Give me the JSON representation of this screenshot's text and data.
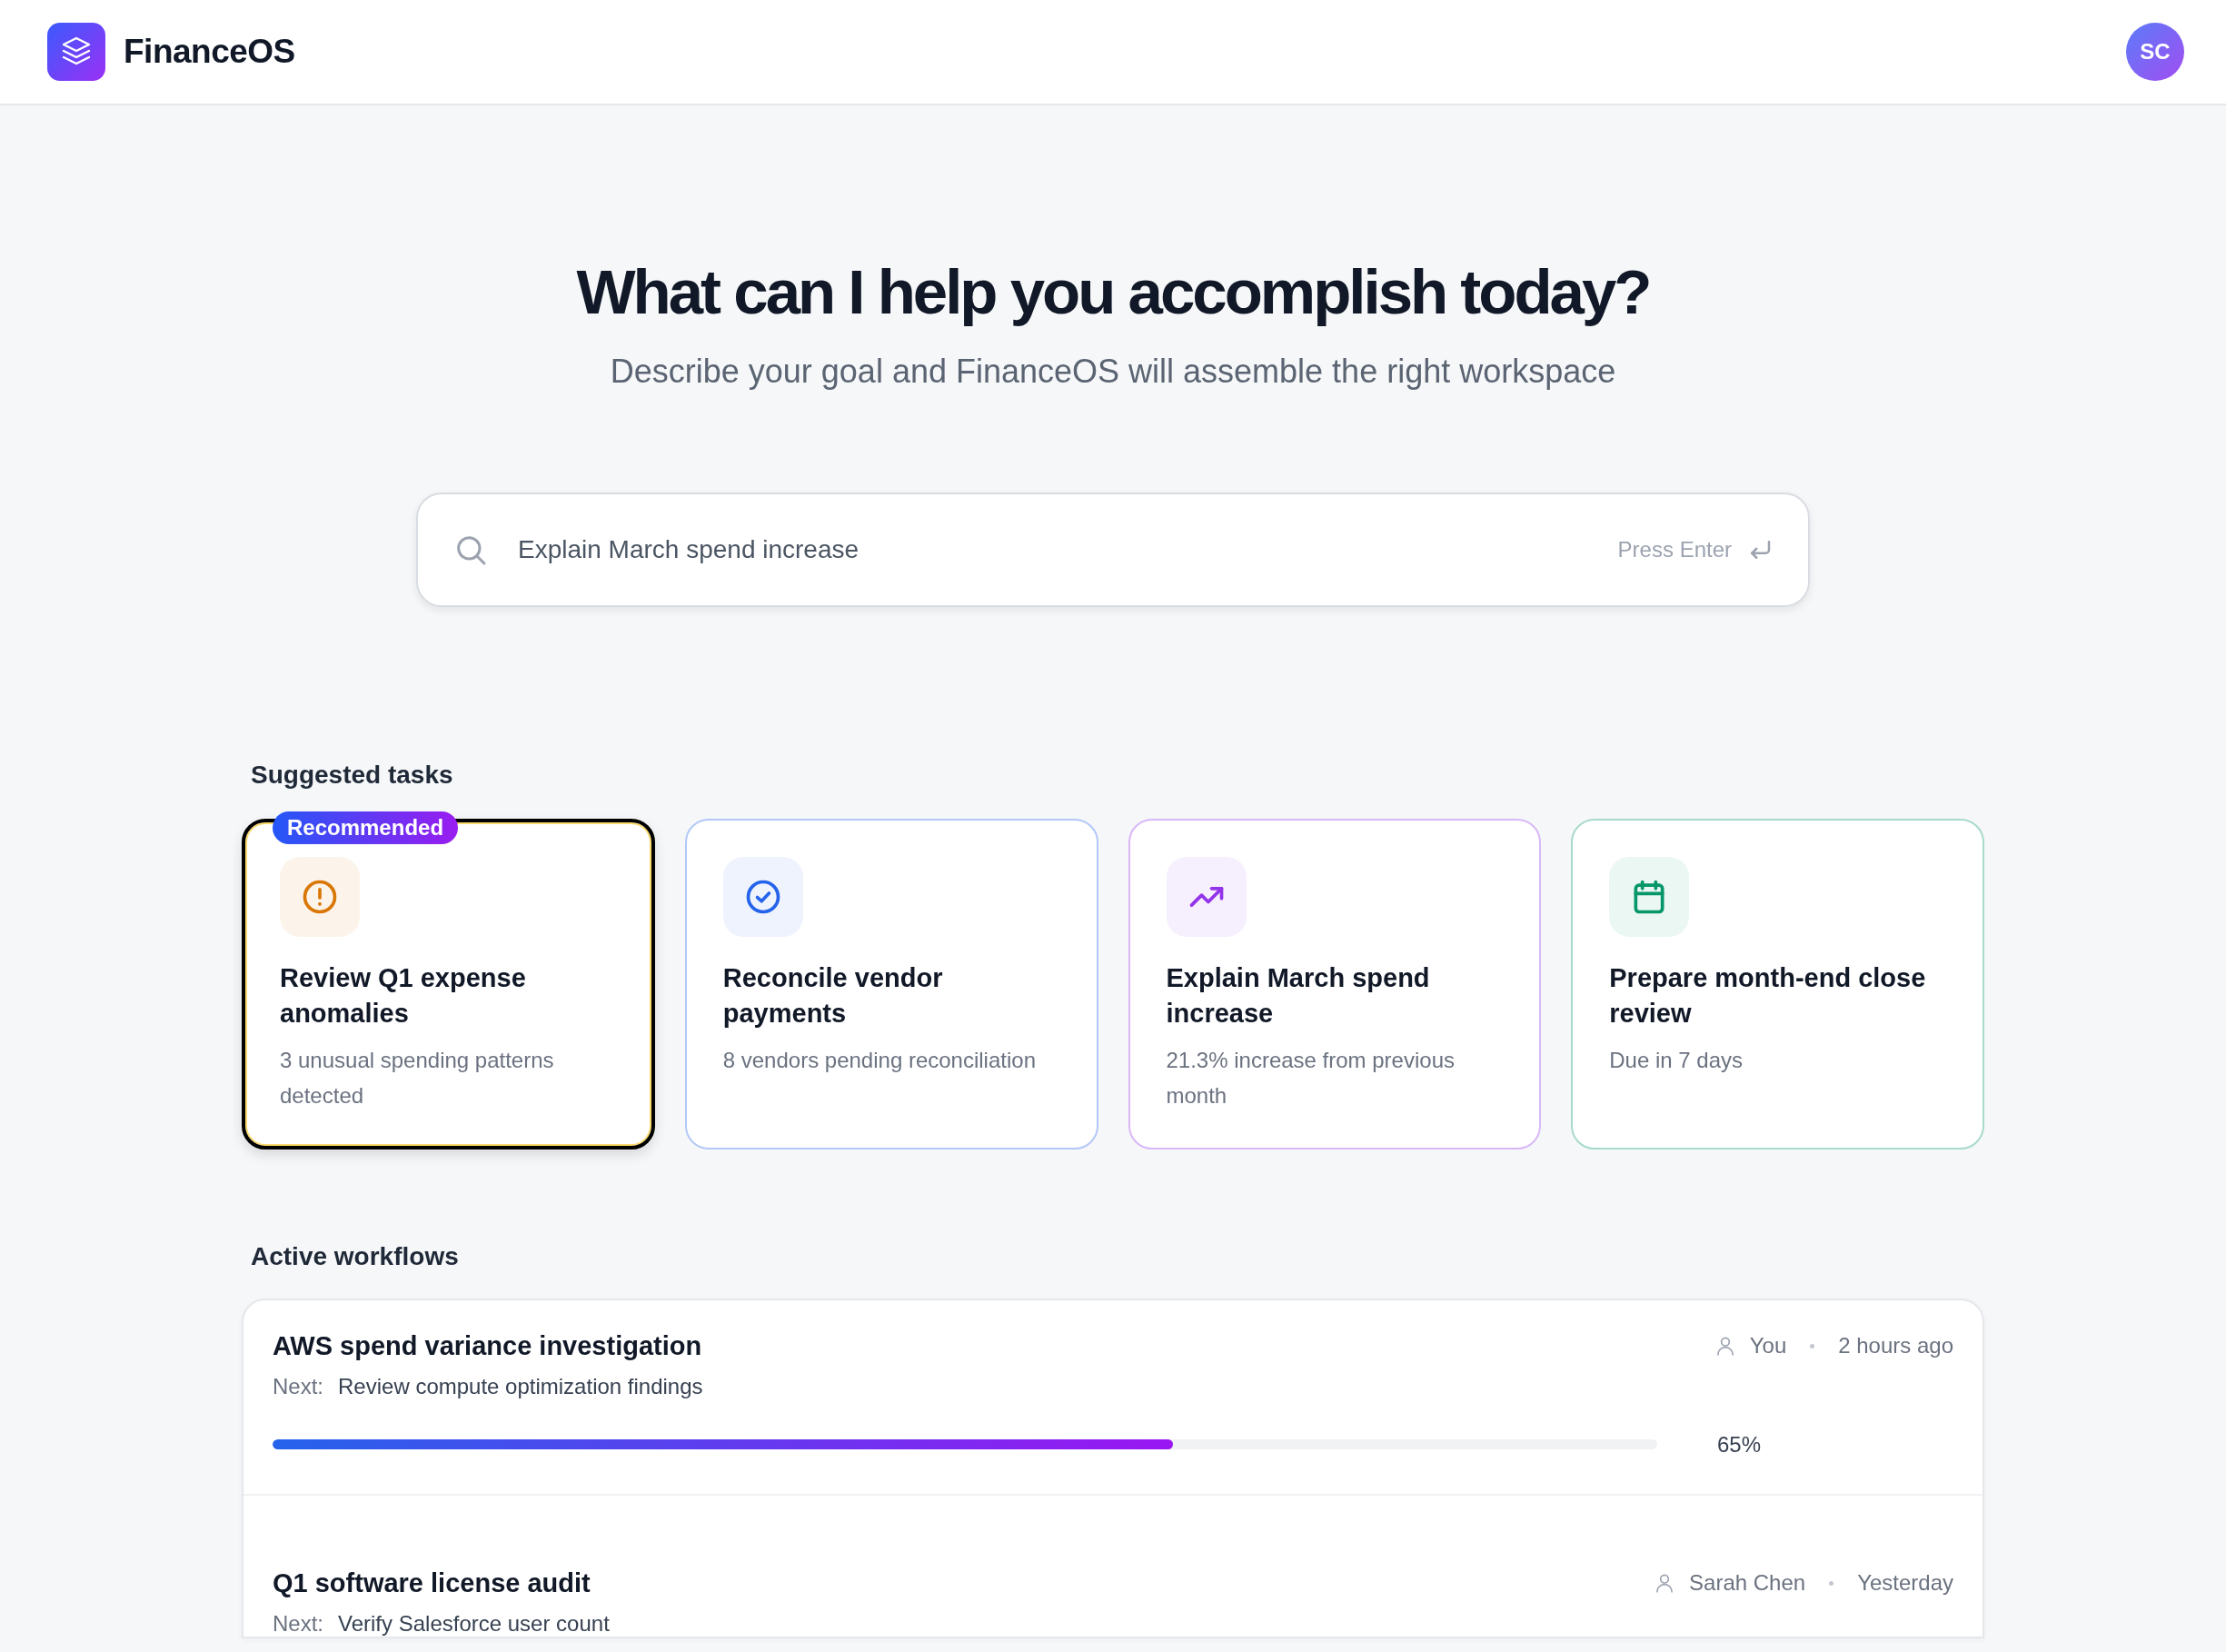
{
  "header": {
    "app_name": "FinanceOS",
    "avatar": "SC"
  },
  "hero": {
    "title": "What can I help you accomplish today?",
    "subtitle": "Describe your goal and FinanceOS will assemble the right workspace"
  },
  "search": {
    "value": "Explain March spend increase",
    "hint": "Press Enter"
  },
  "suggested": {
    "heading": "Suggested tasks",
    "cards": [
      {
        "kind": "alert",
        "color": "#d97706",
        "selected": true,
        "badge": "Recommended",
        "title": "Review Q1 expense anomalies",
        "description": "3 unusual spending patterns detected"
      },
      {
        "kind": "check",
        "color": "#2563eb",
        "selected": false,
        "title": "Reconcile vendor payments",
        "description": "8 vendors pending reconciliation"
      },
      {
        "kind": "trend",
        "color": "#9333ea",
        "selected": false,
        "title": "Explain March spend increase",
        "description": "21.3% increase from previous month"
      },
      {
        "kind": "calendar",
        "color": "#059669",
        "selected": false,
        "title": "Prepare month-end close review",
        "description": "Due in 7 days"
      }
    ]
  },
  "workflows": {
    "heading": "Active workflows",
    "rows": [
      {
        "title": "AWS spend variance investigation",
        "next_label": "Next:",
        "next": "Review compute optimization findings",
        "owner": "You",
        "time": "2 hours ago",
        "level": 0.65,
        "percent": "65%"
      },
      {
        "title": "Q1 software license audit",
        "next_label": "Next:",
        "next": "Verify Salesforce user count",
        "owner": "Sarah Chen",
        "time": "Yesterday"
      }
    ]
  }
}
